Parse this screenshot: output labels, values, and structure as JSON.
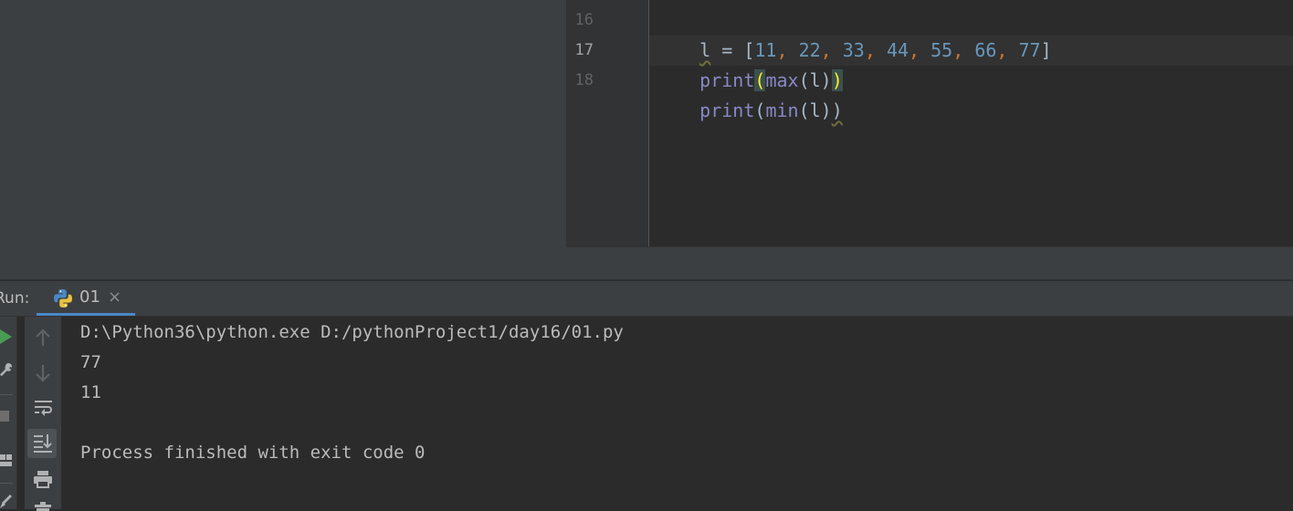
{
  "editor": {
    "lines": [
      {
        "num": "16",
        "code": "l = [11, 22, 33, 44, 55, 66, 77]"
      },
      {
        "num": "17",
        "code": "print(max(l))"
      },
      {
        "num": "18",
        "code": "print(min(l))"
      }
    ],
    "tokens": {
      "var": "l",
      "eq": " = ",
      "lbr": "[",
      "rbr": "]",
      "nums": [
        "11",
        "22",
        "33",
        "44",
        "55",
        "66",
        "77"
      ],
      "comma": ",",
      "print": "print",
      "max": "max",
      "min": "min",
      "lp": "(",
      "rp": ")"
    },
    "colors": {
      "function": "#8888c6",
      "number": "#6897bb",
      "comma": "#cc7832",
      "text": "#a9b7c6",
      "paren_highlight": "#ffef28"
    }
  },
  "run_panel": {
    "label": "Run:",
    "tab": {
      "label": "01",
      "icon": "python-icon",
      "close": "×"
    },
    "accent": "#4a88c7",
    "toolbar": {
      "left": [
        "run-icon",
        "wrench-icon",
        "stop-icon",
        "layout-icon",
        "pin-icon"
      ],
      "right": [
        "arrow-up-icon",
        "arrow-down-icon",
        "soft-wrap-icon",
        "scroll-to-end-icon",
        "print-icon",
        "trash-icon"
      ]
    },
    "output": [
      "D:\\Python36\\python.exe D:/pythonProject1/day16/01.py",
      "77",
      "11",
      "",
      "Process finished with exit code 0"
    ]
  }
}
